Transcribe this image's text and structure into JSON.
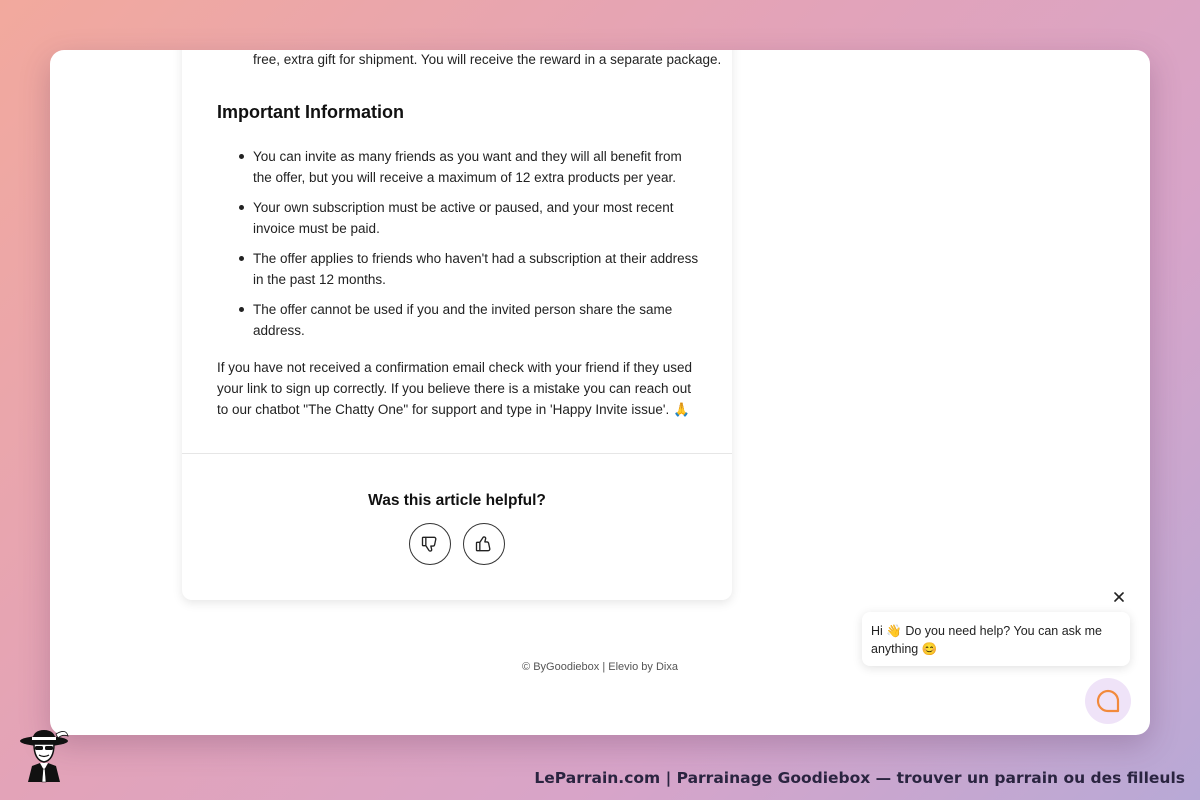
{
  "article": {
    "cut_line": "free, extra gift for shipment. You will receive the reward in a separate package.",
    "heading": "Important Information",
    "bullets": [
      "You can invite as many friends as you want and they will all benefit from the offer, but you will receive a maximum of 12 extra products per year.",
      "Your own subscription must be active or paused, and your most recent invoice must be paid.",
      "The offer applies to friends who haven't had a subscription at their address in the past 12 months.",
      "The offer cannot be used if you and the invited person share the same address."
    ],
    "closing_paragraph": "If you have not received a confirmation email check with your friend if they used your link to sign up correctly. If you believe there is a mistake you can reach out to our chatbot \"The Chatty One\" for support and type in 'Happy Invite issue'. 🙏"
  },
  "feedback": {
    "question": "Was this article helpful?",
    "thumbs_down_icon": "thumbs-down-icon",
    "thumbs_up_icon": "thumbs-up-icon"
  },
  "footer": {
    "copyright": "© ByGoodiebox",
    "separator": "|",
    "powered_by": "Elevio by Dixa"
  },
  "chat": {
    "message": "Hi 👋 Do you need help? You can ask me anything 😊",
    "close_icon": "close-icon",
    "launcher_icon": "chat-bubble-icon",
    "accent_color": "#f28a3c"
  },
  "caption": {
    "text": "LeParrain.com | Parrainage Goodiebox — trouver un parrain ou des filleuls"
  }
}
